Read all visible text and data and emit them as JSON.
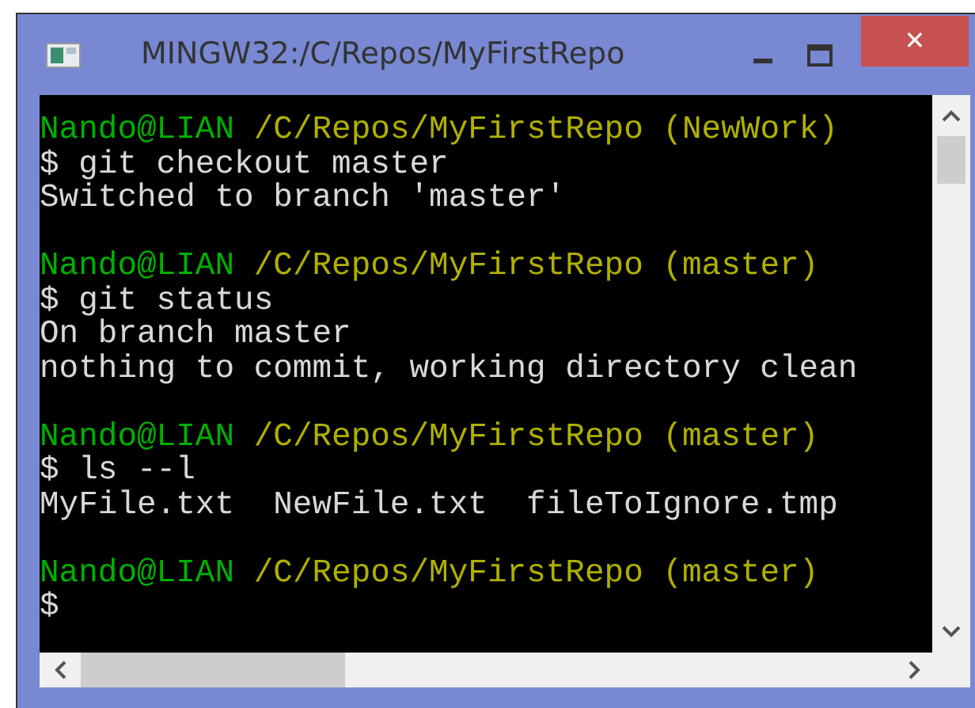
{
  "window": {
    "title": "MINGW32:/C/Repos/MyFirstRepo",
    "close_label": "✕"
  },
  "terminal": {
    "lines": [
      {
        "kind": "prompt",
        "user": "Nando@LIAN",
        "path": "/C/Repos/MyFirstRepo",
        "branch": "(NewWork)"
      },
      {
        "kind": "command",
        "text": "$ git checkout master"
      },
      {
        "kind": "output",
        "text": "Switched to branch 'master'"
      },
      {
        "kind": "blank"
      },
      {
        "kind": "prompt",
        "user": "Nando@LIAN",
        "path": "/C/Repos/MyFirstRepo",
        "branch": "(master)"
      },
      {
        "kind": "command",
        "text": "$ git status"
      },
      {
        "kind": "output",
        "text": "On branch master"
      },
      {
        "kind": "output",
        "text": "nothing to commit, working directory clean"
      },
      {
        "kind": "blank"
      },
      {
        "kind": "prompt",
        "user": "Nando@LIAN",
        "path": "/C/Repos/MyFirstRepo",
        "branch": "(master)"
      },
      {
        "kind": "command",
        "text": "$ ls --l"
      },
      {
        "kind": "output",
        "text": "MyFile.txt  NewFile.txt  fileToIgnore.tmp"
      },
      {
        "kind": "blank"
      },
      {
        "kind": "prompt",
        "user": "Nando@LIAN",
        "path": "/C/Repos/MyFirstRepo",
        "branch": "(master)"
      },
      {
        "kind": "command",
        "text": "$"
      }
    ]
  }
}
